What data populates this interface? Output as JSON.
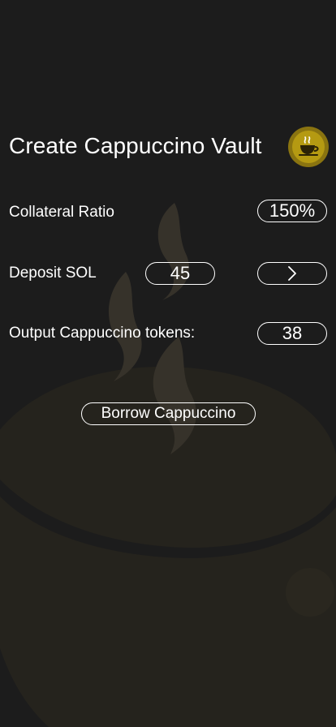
{
  "header": {
    "title": "Create Cappuccino Vault",
    "logo_icon": "cappuccino-cup-icon"
  },
  "collateral": {
    "label": "Collateral Ratio",
    "value": "150%"
  },
  "deposit": {
    "label": "Deposit SOL",
    "value": "45",
    "next_icon": "chevron-right-icon"
  },
  "output": {
    "label": "Output Cappuccino tokens:",
    "value": "38"
  },
  "actions": {
    "borrow_label": "Borrow Cappuccino"
  },
  "colors": {
    "background": "#1c1c1c",
    "cup": "#26241d",
    "steam": "#36322a",
    "logo_gold": "#b59a12",
    "text": "#ffffff"
  }
}
